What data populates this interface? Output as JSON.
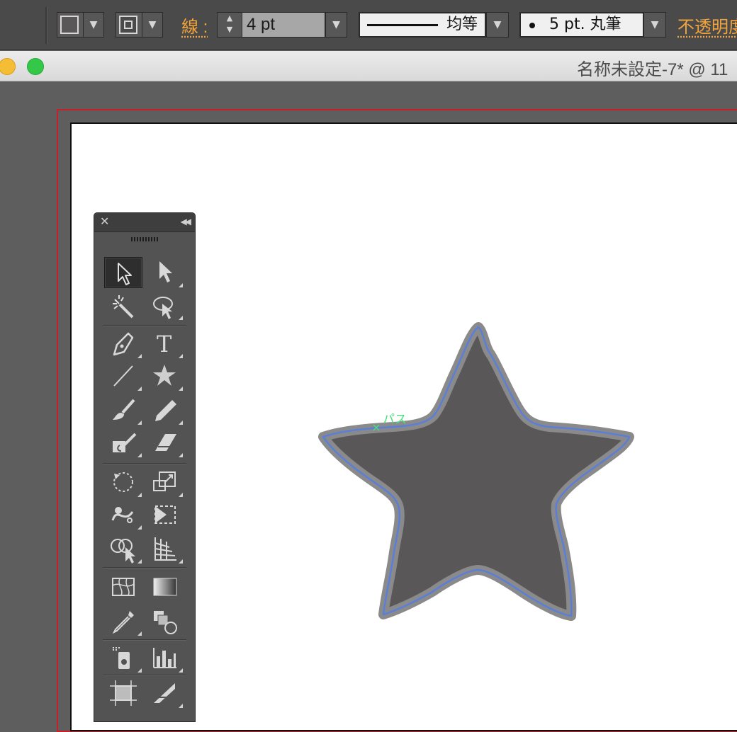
{
  "control_bar": {
    "stroke_label": "線 :",
    "stroke_weight": "4 pt",
    "profile_label": "均等",
    "brush_label": "5 pt. 丸筆",
    "opacity_label": "不透明度"
  },
  "document": {
    "title": "名称未設定-7* @ 11"
  },
  "canvas": {
    "smart_guide_label": "パス",
    "star_fill": "#5a5758",
    "stroke_color": "#8a8a8a",
    "selection_color": "#5b7fd9",
    "guide_color": "#47e07a"
  },
  "tools_panel": {
    "close_glyph": "✕",
    "collapse_glyph": "◀◀",
    "tools": [
      "selection-tool",
      "direct-selection-tool",
      "magic-wand-tool",
      "lasso-tool",
      "pen-tool",
      "type-tool",
      "line-segment-tool",
      "star-tool",
      "paintbrush-tool",
      "pencil-tool",
      "blob-brush-tool",
      "eraser-tool",
      "rotate-tool",
      "scale-tool",
      "warp-tool",
      "free-transform-tool",
      "shape-builder-tool",
      "perspective-grid-tool",
      "mesh-tool",
      "gradient-tool",
      "eyedropper-tool",
      "blend-tool",
      "symbol-sprayer-tool",
      "column-graph-tool",
      "artboard-tool",
      "slice-tool"
    ]
  }
}
